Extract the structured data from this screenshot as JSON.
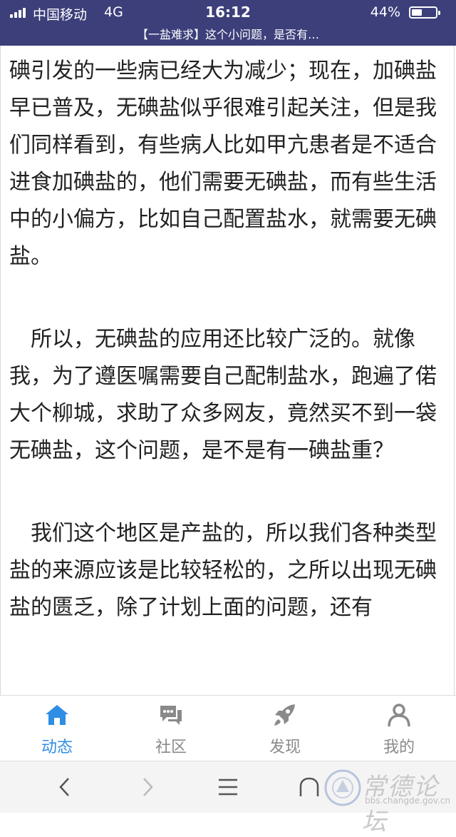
{
  "status_bar": {
    "carrier": "中国移动",
    "network": "4G",
    "time": "16:12",
    "battery_percent_text": "44%",
    "battery_level": 0.44
  },
  "header": {
    "title": "【一盐难求】这个小问题，是否有…"
  },
  "article": {
    "paragraphs": [
      "碘引发的一些病已经大为减少；现在，加碘盐早已普及，无碘盐似乎很难引起关注，但是我们同样看到，有些病人比如甲亢患者是不适合进食加碘盐的，他们需要无碘盐，而有些生活中的小偏方，比如自己配置盐水，就需要无碘盐。",
      "所以，无碘盐的应用还比较广泛的。就像我，为了遵医嘱需要自己配制盐水，跑遍了偌大个柳城，求助了众多网友，竟然买不到一袋无碘盐，这个问题，是不是有一碘盐重？",
      "我们这个地区是产盐的，所以我们各种类型盐的来源应该是比较轻松的，之所以出现无碘盐的匮乏，除了计划上面的问题，还有"
    ]
  },
  "tabbar": {
    "tabs": [
      {
        "label": "动态",
        "icon": "home-icon",
        "active": true
      },
      {
        "label": "社区",
        "icon": "chat-bubbles-icon",
        "active": false
      },
      {
        "label": "发现",
        "icon": "rocket-icon",
        "active": false
      },
      {
        "label": "我的",
        "icon": "person-icon",
        "active": false
      }
    ],
    "active_color": "#2f8de4",
    "inactive_color": "#8a8a8a"
  },
  "toolbar": {
    "buttons": [
      "back-icon",
      "forward-icon",
      "menu-icon",
      "home-outline-icon"
    ]
  },
  "watermark": {
    "text": "常德论坛",
    "url": "bbs.changde.gov.cn"
  },
  "colors": {
    "header_bg": "#3c3f7a",
    "text": "#222222"
  }
}
